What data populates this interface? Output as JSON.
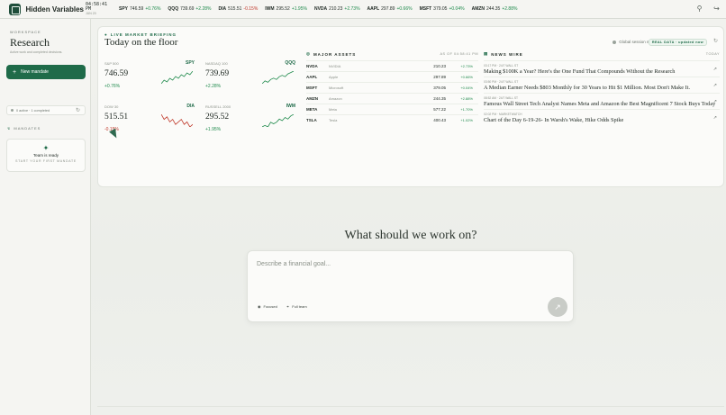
{
  "app": {
    "name": "Hidden Variables",
    "time": "04:58:41 PM",
    "date": "JUN 20"
  },
  "ticker": [
    {
      "sym": "SPY",
      "val": "746.59",
      "chg": "+0.76%",
      "dir": "pos"
    },
    {
      "sym": "QQQ",
      "val": "739.69",
      "chg": "+2.28%",
      "dir": "pos"
    },
    {
      "sym": "DIA",
      "val": "515.51",
      "chg": "-0.15%",
      "dir": "neg"
    },
    {
      "sym": "IWM",
      "val": "295.52",
      "chg": "+1.95%",
      "dir": "pos"
    },
    {
      "sym": "NVDA",
      "val": "210.23",
      "chg": "+2.73%",
      "dir": "pos"
    },
    {
      "sym": "AAPL",
      "val": "297.89",
      "chg": "+0.66%",
      "dir": "pos"
    },
    {
      "sym": "MSFT",
      "val": "379.05",
      "chg": "+0.04%",
      "dir": "pos"
    },
    {
      "sym": "AMZN",
      "val": "244.35",
      "chg": "+2.88%",
      "dir": "pos"
    }
  ],
  "sidebar": {
    "workspace_label": "WORKSPACE",
    "title": "Research",
    "subtitle": "Active work and completed decisions.",
    "new_mandate": "New mandate",
    "status": "0 active · 1 completed",
    "mandates_label": "MANDATES",
    "team_ready": "Team is ready",
    "team_sub": "START YOUR FIRST MANDATE"
  },
  "briefing": {
    "label": "LIVE MARKET BRIEFING",
    "title": "Today on the floor",
    "monitor": "Global session monitor",
    "badge": "REAL DATA · updated now"
  },
  "tiles": [
    {
      "label": "S&P 500",
      "sym": "SPY",
      "val": "746.59",
      "chg": "+0.76%",
      "dir": "pos",
      "spark": [
        3,
        5,
        4,
        6,
        5,
        7,
        6,
        8,
        7,
        9,
        8,
        10
      ]
    },
    {
      "label": "NASDAQ 100",
      "sym": "QQQ",
      "val": "739.69",
      "chg": "+2.28%",
      "dir": "pos",
      "spark": [
        2,
        4,
        3,
        5,
        6,
        5,
        7,
        8,
        7,
        9,
        10,
        11
      ]
    },
    {
      "label": "DOW 30",
      "sym": "DIA",
      "val": "515.51",
      "chg": "-0.15%",
      "dir": "neg",
      "spark": [
        8,
        6,
        7,
        5,
        6,
        4,
        5,
        6,
        4,
        5,
        3,
        4
      ]
    },
    {
      "label": "RUSSELL 2000",
      "sym": "IWM",
      "val": "295.52",
      "chg": "+1.95%",
      "dir": "pos",
      "spark": [
        3,
        4,
        3,
        6,
        5,
        6,
        8,
        7,
        9,
        8,
        10,
        11
      ]
    }
  ],
  "assets": {
    "label": "MAJOR ASSETS",
    "asof": "AS OF 04:58:41 PM",
    "rows": [
      {
        "sym": "NVDA",
        "name": "NVIDIA",
        "price": "210.23",
        "chg": "+2.73%",
        "dir": "pos"
      },
      {
        "sym": "AAPL",
        "name": "Apple",
        "price": "297.89",
        "chg": "+0.66%",
        "dir": "pos"
      },
      {
        "sym": "MSFT",
        "name": "Microsoft",
        "price": "379.05",
        "chg": "+0.04%",
        "dir": "pos"
      },
      {
        "sym": "AMZN",
        "name": "Amazon",
        "price": "244.35",
        "chg": "+2.88%",
        "dir": "pos"
      },
      {
        "sym": "META",
        "name": "Meta",
        "price": "577.22",
        "chg": "+1.70%",
        "dir": "pos"
      },
      {
        "sym": "TSLA",
        "name": "Tesla",
        "price": "400.43",
        "chg": "+1.02%",
        "dir": "pos"
      }
    ]
  },
  "news": {
    "label": "NEWS WIRE",
    "today": "TODAY",
    "rows": [
      {
        "meta": "03:17 PM · 24/7 WALL ST",
        "headline": "Making $100K a Year? Here's the One Fund That Compounds Without the Research"
      },
      {
        "meta": "03:50 PM · 24/7 WALL ST",
        "headline": "A Median Earner Needs $803 Monthly for 30 Years to Hit $1 Million. Most Don't Make It."
      },
      {
        "meta": "08:52 AM · 24/7 WALL ST",
        "headline": "Famous Wall Street Tech Analyst Names Meta and Amazon the Best Magnificent 7 Stock Buys Today"
      },
      {
        "meta": "02:02 PM · MARKETWATCH",
        "headline": "Chart of the Day 6-19-26- In Warsh's Wake, Hike Odds Spike"
      }
    ]
  },
  "prompt": {
    "title": "What should we work on?",
    "placeholder": "Describe a financial goal...",
    "mode_focused": "Focused",
    "mode_full": "Full team"
  }
}
